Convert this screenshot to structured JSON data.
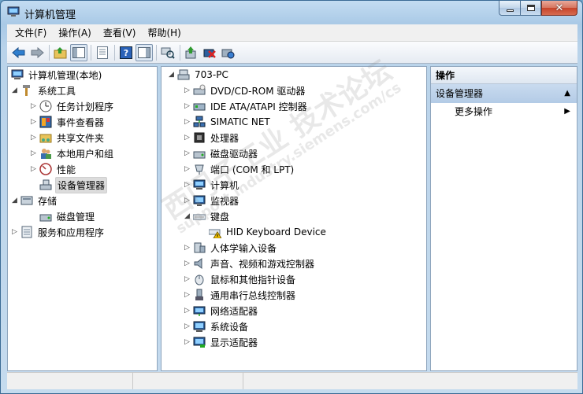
{
  "window": {
    "title": "计算机管理"
  },
  "menu": [
    "文件(F)",
    "操作(A)",
    "查看(V)",
    "帮助(H)"
  ],
  "toolbar": [
    "back-icon",
    "forward-icon",
    "up-folder-icon",
    "show-hide-tree-icon",
    "export-list-icon",
    "help-icon",
    "show-hide-action-icon",
    "scan-hardware-icon",
    "update-driver-icon",
    "disable-device-icon",
    "uninstall-device-icon"
  ],
  "left_tree": {
    "root": "计算机管理(本地)",
    "system_tools": "系统工具",
    "task_scheduler": "任务计划程序",
    "event_viewer": "事件查看器",
    "shared_folders": "共享文件夹",
    "local_users": "本地用户和组",
    "performance": "性能",
    "device_manager": "设备管理器",
    "storage": "存储",
    "disk_management": "磁盘管理",
    "services_apps": "服务和应用程序"
  },
  "device_tree": {
    "root": "703-PC",
    "categories": [
      {
        "label": "DVD/CD-ROM 驱动器",
        "icon": "dvd-drive-icon"
      },
      {
        "label": "IDE ATA/ATAPI 控制器",
        "icon": "ide-controller-icon"
      },
      {
        "label": "SIMATIC NET",
        "icon": "network-icon"
      },
      {
        "label": "处理器",
        "icon": "processor-icon"
      },
      {
        "label": "磁盘驱动器",
        "icon": "disk-drive-icon"
      },
      {
        "label": "端口 (COM 和 LPT)",
        "icon": "port-icon"
      },
      {
        "label": "计算机",
        "icon": "computer-icon"
      },
      {
        "label": "监视器",
        "icon": "monitor-icon"
      },
      {
        "label": "键盘",
        "icon": "keyboard-icon"
      },
      {
        "label": "人体学输入设备",
        "icon": "hid-icon"
      },
      {
        "label": "声音、视频和游戏控制器",
        "icon": "sound-icon"
      },
      {
        "label": "鼠标和其他指针设备",
        "icon": "mouse-icon"
      },
      {
        "label": "通用串行总线控制器",
        "icon": "usb-icon"
      },
      {
        "label": "网络适配器",
        "icon": "network-adapter-icon"
      },
      {
        "label": "系统设备",
        "icon": "system-device-icon"
      },
      {
        "label": "显示适配器",
        "icon": "display-adapter-icon"
      }
    ],
    "keyboard_child": "HID Keyboard Device"
  },
  "actions": {
    "header": "操作",
    "section": "设备管理器",
    "more": "更多操作"
  },
  "watermark": {
    "text": "西门子工业 技术论坛",
    "url": "support.industry.siemens.com/cs"
  }
}
